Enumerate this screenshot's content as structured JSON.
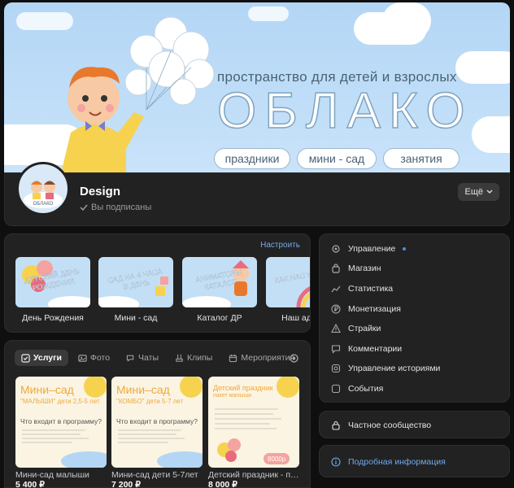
{
  "cover": {
    "subtitle": "пространство для детей и взрослых",
    "title": "ОБЛАКО",
    "pills": [
      "праздники",
      "мини - сад",
      "занятия"
    ]
  },
  "header": {
    "name": "Design",
    "status": "Вы подписаны",
    "more": "Ещё"
  },
  "stories": {
    "customize": "Настроить",
    "items": [
      {
        "label": "День Рождения",
        "thumb_text": "ДЕТСКИЙ ДЕНЬ РОЖДЕНИЯ"
      },
      {
        "label": "Мини - сад",
        "thumb_text": "САД НА 4 ЧАСА В ДЕНЬ"
      },
      {
        "label": "Каталог ДР",
        "thumb_text": "АНИМАТОРЫ КАТАЛОГ"
      },
      {
        "label": "Наш адрес",
        "thumb_text": "КАК НАС НАЙТИ"
      }
    ]
  },
  "tabs": [
    "Услуги",
    "Фото",
    "Чаты",
    "Клипы",
    "Мероприятия"
  ],
  "products": [
    {
      "name": "Мини-сад малыши",
      "price": "5 400 ₽",
      "title": "Мини–сад",
      "sub": "\"МАЛЫШИ\" дети 2,5-5 лет",
      "q": "Что входит в программу?"
    },
    {
      "name": "Мини-сад дети 5-7лет",
      "price": "7 200 ₽",
      "title": "Мини–сад",
      "sub": "\"КОМБО\" дети 5-7 лет",
      "q": "Что входит в программу?"
    },
    {
      "name": "Детский праздник - пакет малыши",
      "price": "8 000 ₽",
      "title": "Детский праздник",
      "sub": "пакет малыши",
      "badge": "8000р"
    }
  ],
  "menu": {
    "items": [
      {
        "label": "Управление",
        "icon": "gear-icon"
      },
      {
        "label": "Магазин",
        "icon": "bag-icon"
      },
      {
        "label": "Статистика",
        "icon": "chart-icon"
      },
      {
        "label": "Монетизация",
        "icon": "ruble-icon"
      },
      {
        "label": "Страйки",
        "icon": "warning-icon"
      },
      {
        "label": "Комментарии",
        "icon": "comment-icon"
      },
      {
        "label": "Управление историями",
        "icon": "stories-icon"
      },
      {
        "label": "События",
        "icon": "event-icon"
      }
    ],
    "private": "Частное сообщество",
    "details": "Подробная информация"
  },
  "colors": {
    "accent": "#71aaeb",
    "panel": "#222222",
    "background": "#0f0f0f"
  }
}
